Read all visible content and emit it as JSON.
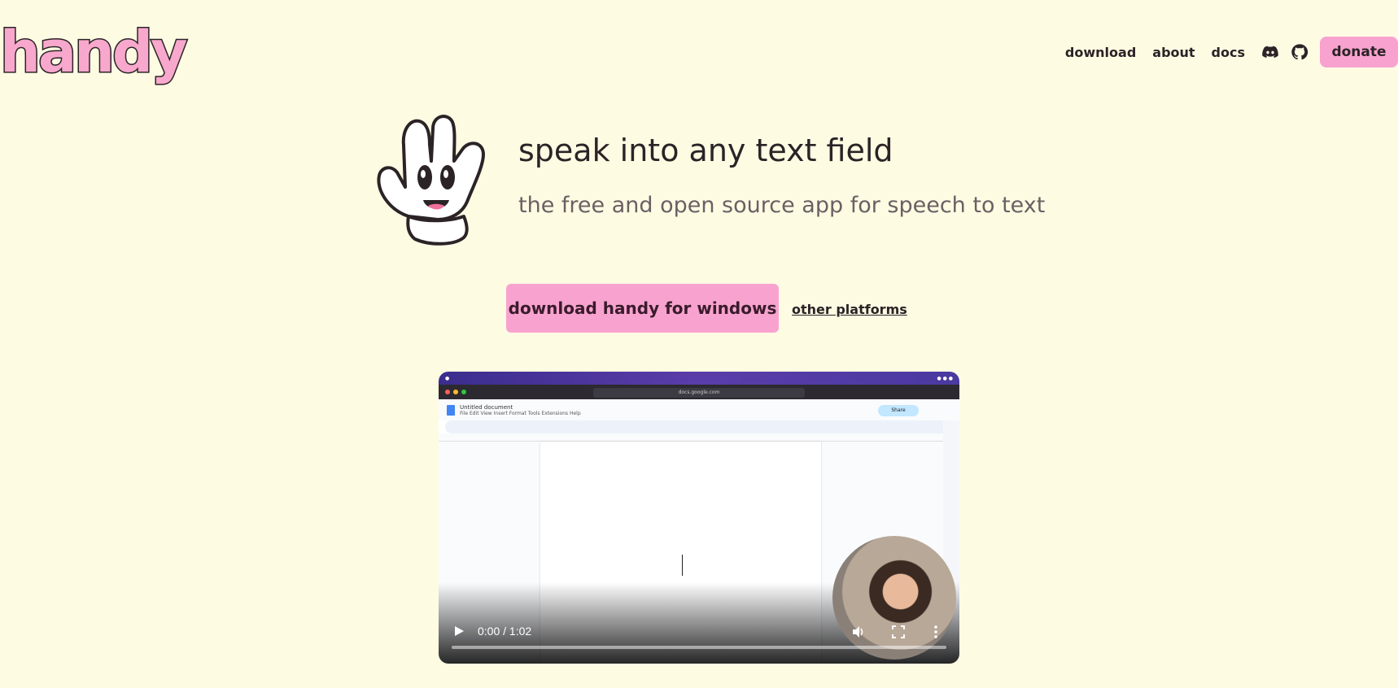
{
  "logo": "handy",
  "nav": {
    "download": "download",
    "about": "about",
    "docs": "docs",
    "donate": "donate"
  },
  "hero": {
    "headline": "speak into any text field",
    "subline": "the free and open source app for speech to text",
    "cta": "download handy for windows",
    "other": "other platforms"
  },
  "video": {
    "time": "0:00 / 1:02",
    "doc_title": "Untitled document",
    "doc_menu": "File  Edit  View  Insert  Format  Tools  Extensions  Help",
    "url": "docs.google.com",
    "share": "Share"
  },
  "colors": {
    "background": "#fefbe3",
    "accent": "#f8a3cf",
    "text": "#2b2326"
  }
}
